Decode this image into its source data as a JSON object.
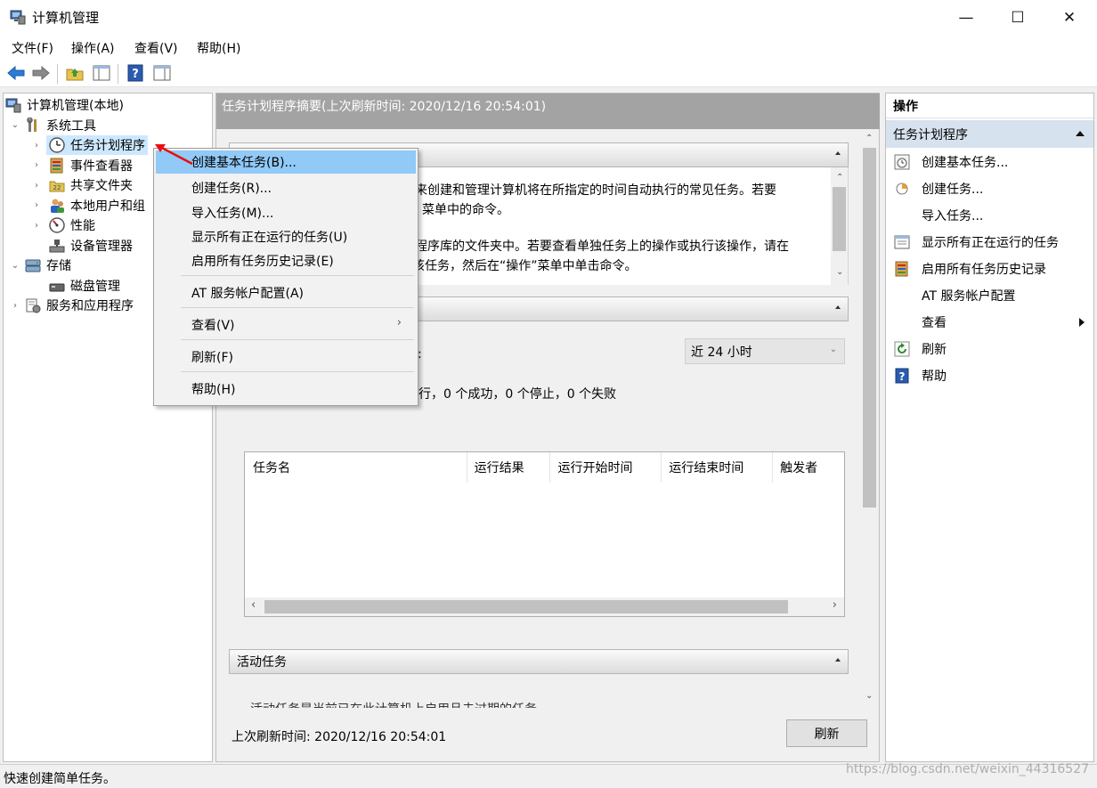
{
  "window": {
    "title": "计算机管理",
    "minimize_glyph": "—",
    "maximize_glyph": "☐",
    "close_glyph": "✕"
  },
  "menubar": [
    "文件(F)",
    "操作(A)",
    "查看(V)",
    "帮助(H)"
  ],
  "tree": {
    "root": "计算机管理(本地)",
    "system_tools": "系统工具",
    "task_scheduler": "任务计划程序",
    "event_viewer": "事件查看器",
    "shared_folders": "共享文件夹",
    "local_users": "本地用户和组",
    "performance": "性能",
    "device_manager": "设备管理器",
    "storage": "存储",
    "disk_management": "磁盘管理",
    "services_apps": "服务和应用程序"
  },
  "center": {
    "summary_title": "任务计划程序摘要(上次刷新时间: 2020/12/16 20:54:01)",
    "overview_line1": "来创建和管理计算机将在所指定的时间自动执行的常见任务。若要",
    "overview_line2": "菜单中的命令。",
    "overview_line3": "程序库的文件夹中。若要查看单独任务上的操作或执行该操作，请在",
    "overview_line4": "该任务，然后在“操作”菜单中单击命令。",
    "status_colon": ":",
    "period_select": "近 24 小时",
    "status_summary": "行，0 个成功，0 个停止，0 个失败",
    "table_headers": [
      "任务名",
      "运行结果",
      "运行开始时间",
      "运行结束时间",
      "触发者"
    ],
    "active_tasks_title": "活动任务",
    "active_tasks_partial": "活动任务是当前已在此计算机上启用且未过期的任务。",
    "last_refresh": "上次刷新时间: 2020/12/16 20:54:01",
    "refresh_button": "刷新"
  },
  "actions": {
    "header": "操作",
    "section": "任务计划程序",
    "items": [
      "创建基本任务...",
      "创建任务...",
      "导入任务...",
      "显示所有正在运行的任务",
      "启用所有任务历史记录",
      "AT 服务帐户配置",
      "查看",
      "刷新",
      "帮助"
    ]
  },
  "context_menu": {
    "items": [
      "创建基本任务(B)...",
      "创建任务(R)...",
      "导入任务(M)...",
      "显示所有正在运行的任务(U)",
      "启用所有任务历史记录(E)",
      "AT 服务帐户配置(A)",
      "查看(V)",
      "刷新(F)",
      "帮助(H)"
    ],
    "submenu_glyph": "›"
  },
  "statusbar": {
    "text": "快速创建简单任务。",
    "watermark": "https://blog.csdn.net/weixin_44316527"
  },
  "colors": {
    "selection": "#cce8ff",
    "menu_highlight": "#91c9f7",
    "summary_header": "#a3a3a3",
    "actions_section": "#d7e2ef",
    "annotation_arrow": "#e81010"
  }
}
